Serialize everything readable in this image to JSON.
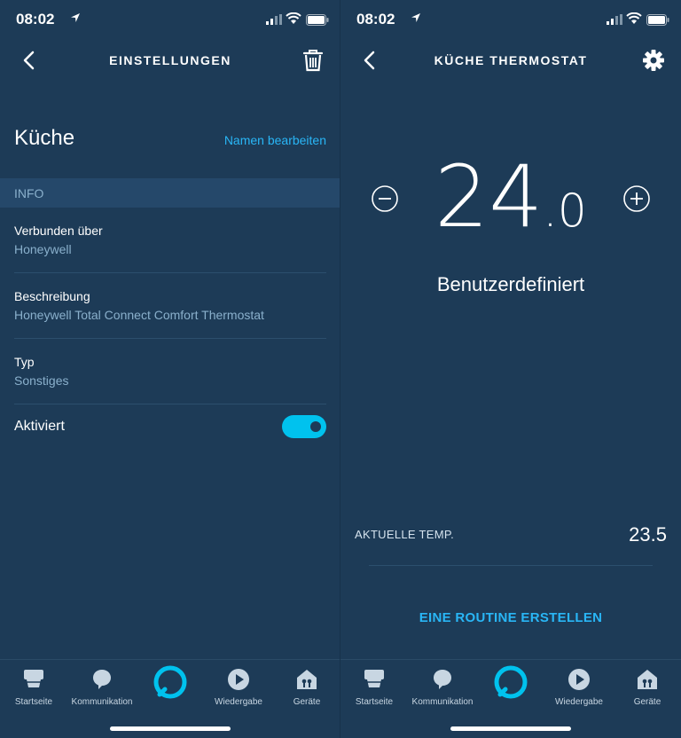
{
  "left": {
    "status_time": "08:02",
    "title": "EINSTELLUNGEN",
    "device_name": "Küche",
    "rename_link": "Namen bearbeiten",
    "section": "INFO",
    "rows": [
      {
        "label": "Verbunden über",
        "value": "Honeywell"
      },
      {
        "label": "Beschreibung",
        "value": "Honeywell Total Connect Comfort Thermostat"
      },
      {
        "label": "Typ",
        "value": "Sonstiges"
      }
    ],
    "enabled_label": "Aktiviert",
    "enabled": true
  },
  "right": {
    "status_time": "08:02",
    "title": "KÜCHE THERMOSTAT",
    "setpoint_int": "24",
    "setpoint_dec": ".0",
    "mode": "Benutzerdefiniert",
    "current_label": "AKTUELLE TEMP.",
    "current_value": "23.5",
    "routine_button": "EINE ROUTINE ERSTELLEN"
  },
  "tabs": [
    {
      "label": "Startseite",
      "icon": "home-icon"
    },
    {
      "label": "Kommunikation",
      "icon": "chat-icon"
    },
    {
      "label": "",
      "icon": "alexa-ring-icon"
    },
    {
      "label": "Wiedergabe",
      "icon": "play-icon"
    },
    {
      "label": "Geräte",
      "icon": "devices-icon"
    }
  ],
  "colors": {
    "background": "#1d3b57",
    "accent": "#29b6f6",
    "toggle_on": "#00c2ee",
    "section_bar": "#25486a",
    "secondary_text": "#8ab0cc"
  }
}
